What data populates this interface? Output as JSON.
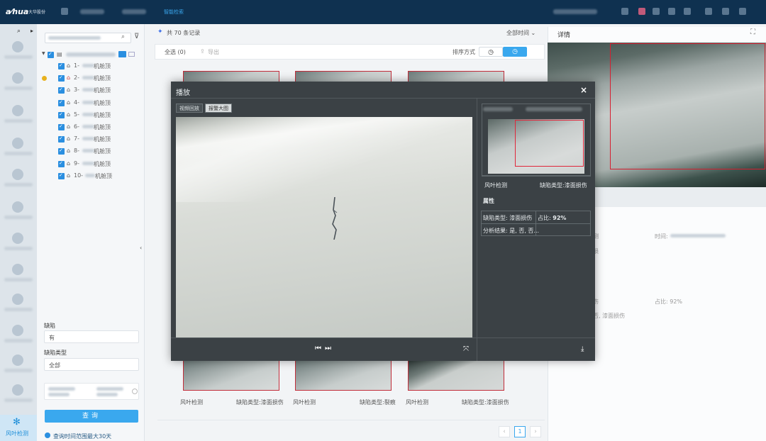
{
  "brand": {
    "logo": "a⁄hua",
    "company": "大华股份"
  },
  "topnav": {
    "active_tab": "智能检索"
  },
  "tree": {
    "group_root": "",
    "items": [
      "1-",
      "2-",
      "3-",
      "4-",
      "5-",
      "6-",
      "7-",
      "8-",
      "9-",
      "10-"
    ],
    "item_suffixes": [
      "机舱顶",
      "机舱顶",
      "机舱顶",
      "机舱顶",
      "机舱顶",
      "机舱顶",
      "机舱顶",
      "机舱顶",
      "机舱顶",
      "机舱顶"
    ],
    "warn_item_index": 1
  },
  "filters": {
    "defect_label": "缺陷",
    "defect_value": "有",
    "defect_type_label": "缺陷类型",
    "defect_type_value": "全部"
  },
  "query_button": "查询",
  "hint": "查询时间范围最大30天",
  "rail": {
    "active_label": "风叶检测"
  },
  "main": {
    "record_count": "共 70 条记录",
    "time_filter": "全部时间",
    "select_all": "全选 (0)",
    "export": "导出",
    "sort_label": "排序方式",
    "captions": [
      {
        "left": "风叶检测",
        "right": "缺陷类型:漆面损伤"
      },
      {
        "left": "风叶检测",
        "right": "缺陷类型:裂痕"
      },
      {
        "left": "风叶检测",
        "right": "缺陷类型:漆面损伤"
      }
    ],
    "pager": {
      "prev": "‹",
      "current": "1",
      "next": "›"
    }
  },
  "detail": {
    "title": "详情",
    "time_label": "时间:",
    "ratio_text": "占比: 92%",
    "result_text": "否, 漆面损伤",
    "defect_text": "伤",
    "row_frag_1": "测",
    "row_frag_2": "损"
  },
  "modal": {
    "title": "播放",
    "close": "×",
    "tabs": [
      "视频回放",
      "报警大图"
    ],
    "side_meta_left": "风叶检测",
    "side_meta_right": "缺陷类型:漆面损伤",
    "attr_title": "属性",
    "attr": {
      "defect_type": "缺陷类型: 漆面损伤",
      "ratio_label": "占比: ",
      "ratio_value": "92%",
      "analysis": "分析结果: 是, 否, 否..."
    }
  },
  "icons": {
    "search": "search-icon",
    "filter": "filter-icon",
    "close": "close-icon",
    "prev": "previous-frame-icon",
    "next": "next-frame-icon",
    "fullscreen": "fullscreen-icon",
    "download": "download-icon",
    "expand": "expand-icon",
    "fan": "fan-icon"
  },
  "colors": {
    "accent": "#3aa8ee",
    "topbar": "#0f3150",
    "defect_box": "#d61f30",
    "modal_bg": "#3b4145"
  }
}
